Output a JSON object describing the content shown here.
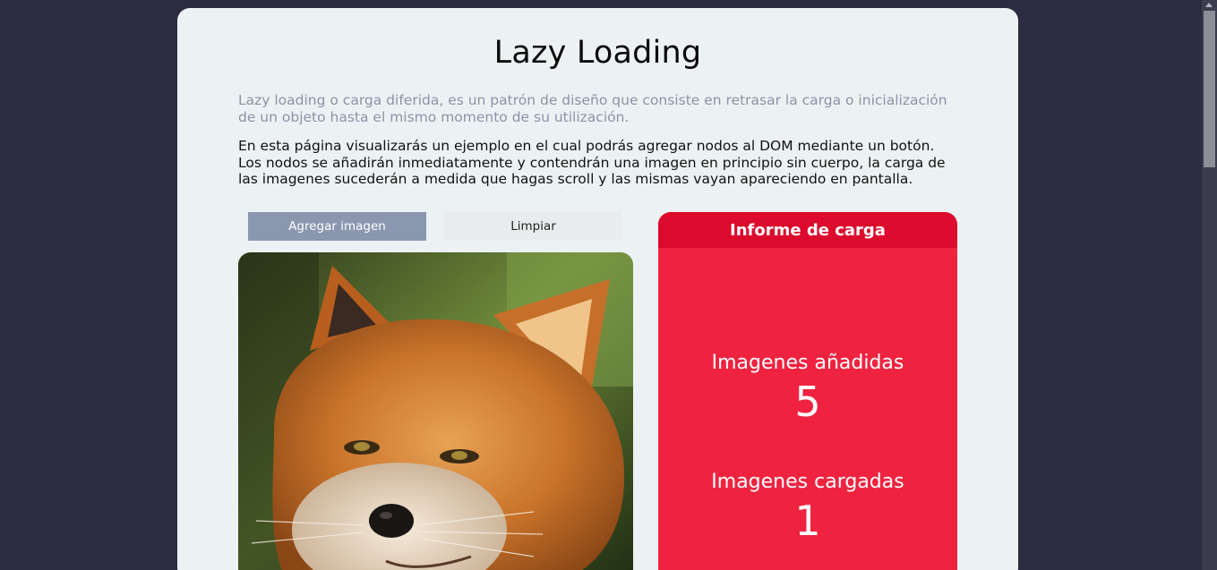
{
  "page": {
    "title": "Lazy Loading",
    "intro": "Lazy loading o carga diferida, es un patrón de diseño que consiste en retrasar la carga o inicialización de un objeto hasta el mismo momento de su utilización.",
    "description": "En esta página visualizarás un ejemplo en el cual podrás agregar nodos al DOM mediante un botón. Los nodos se añadirán inmediatamente y contendrán una imagen en principio sin cuerpo, la carga de las imagenes sucederán a medida que hagas scroll y las mismas vayan apareciendo en pantalla."
  },
  "buttons": {
    "add_label": "Agregar imagen",
    "clear_label": "Limpiar"
  },
  "report": {
    "heading": "Informe de carga",
    "added_label": "Imagenes añadidas",
    "added_value": "5",
    "loaded_label": "Imagenes cargadas",
    "loaded_value": "1"
  },
  "colors": {
    "background": "#2b2c40",
    "card": "#ecf2f3",
    "add_button": "#8a97af",
    "report": "#ef2340",
    "report_header": "#dc0a2c"
  },
  "icons": {
    "image": "fox-photo",
    "scroll_up": "scroll-up-arrow-icon"
  }
}
